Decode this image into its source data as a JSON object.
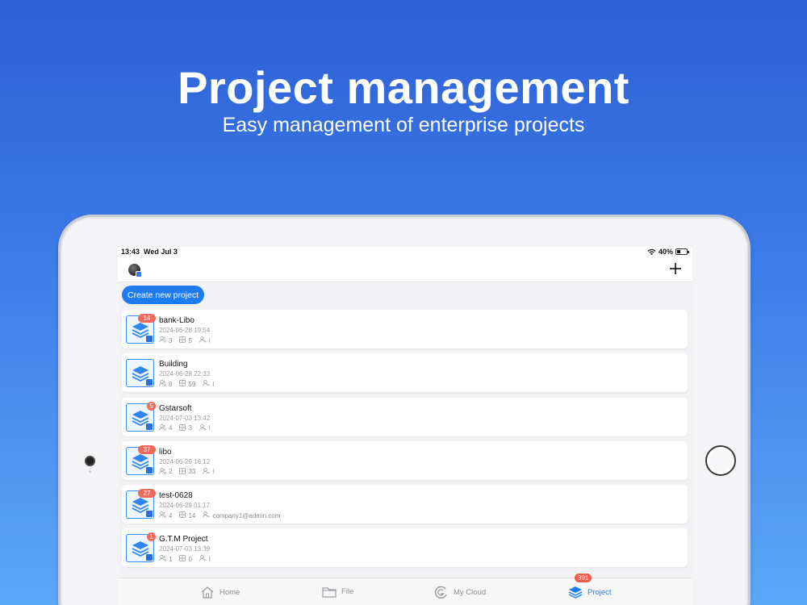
{
  "hero": {
    "title": "Project management",
    "subtitle": "Easy management of enterprise projects"
  },
  "status_bar": {
    "time": "13:43",
    "date": "Wed Jul 3",
    "battery": "40%",
    "battery_level": 0.4
  },
  "header": {
    "avatar_icon": "avatar",
    "add_icon": "plus-icon"
  },
  "create_button_label": "Create new project",
  "projects": [
    {
      "name": "bank-Libo",
      "date": "2024-06-28 19:54",
      "badge": "14",
      "members": "3",
      "items": "5",
      "owner": "l"
    },
    {
      "name": "Building",
      "date": "2024-06-28 22:33",
      "badge": "",
      "members": "8",
      "items": "59",
      "owner": "l"
    },
    {
      "name": "Gstarsoft",
      "date": "2024-07-03 13:42",
      "badge": "5",
      "members": "4",
      "items": "3",
      "owner": "l"
    },
    {
      "name": "libo",
      "date": "2024-06-29 16:12",
      "badge": "37",
      "members": "2",
      "items": "33",
      "owner": "l"
    },
    {
      "name": "test-0628",
      "date": "2024-06-29 01:17",
      "badge": "27",
      "members": "4",
      "items": "14",
      "owner": "company1@admin.com"
    },
    {
      "name": "G.T.M Project",
      "date": "2024-07-03 13:39",
      "badge": "1",
      "members": "1",
      "items": "0",
      "owner": "l"
    }
  ],
  "tabs": [
    {
      "label": "Home",
      "icon": "home-icon"
    },
    {
      "label": "File",
      "icon": "folder-icon"
    },
    {
      "label": "My Cloud",
      "icon": "cloud-icon"
    },
    {
      "label": "Project",
      "icon": "layers-icon",
      "badge": "391"
    }
  ],
  "colors": {
    "accent": "#1f7bf0",
    "badge": "#ef6a5a",
    "background_top": "#2d5fd6",
    "background_bottom": "#5aa8f8"
  }
}
